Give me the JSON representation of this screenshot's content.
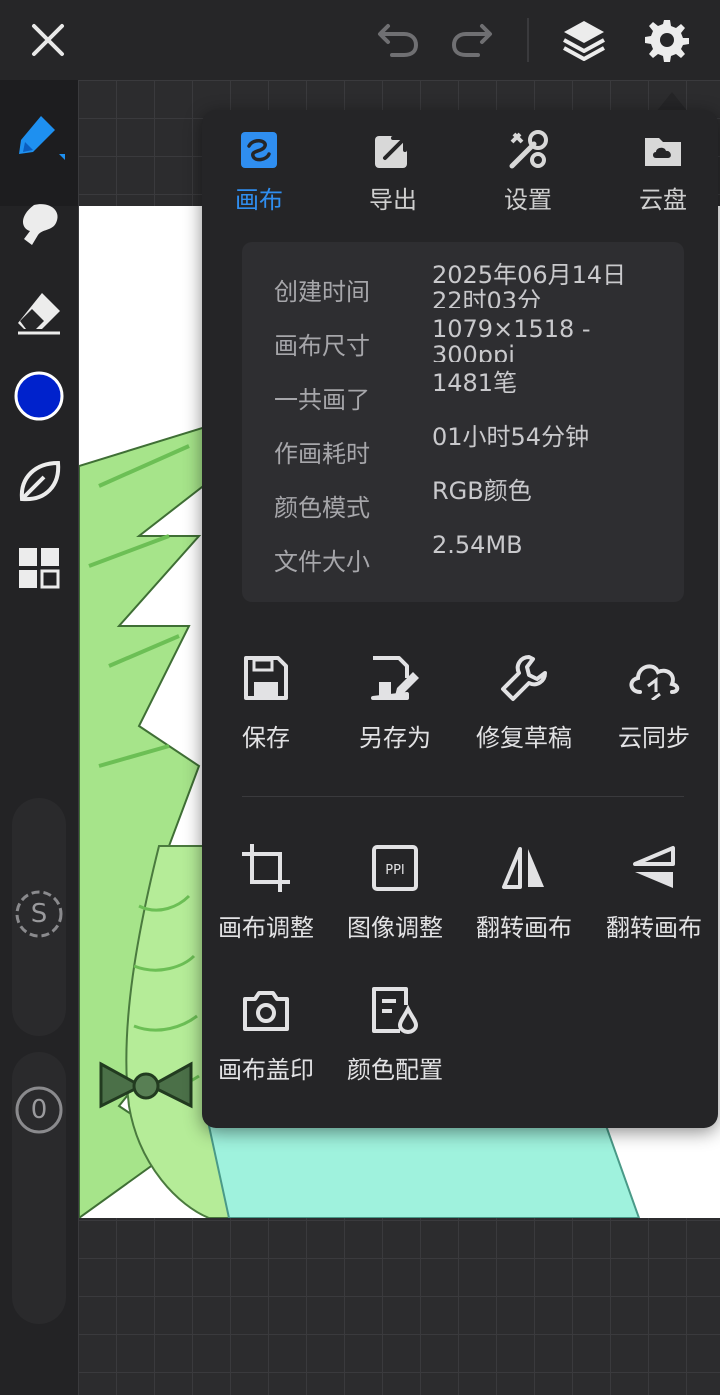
{
  "toolbar": {
    "close_icon": "close-icon",
    "undo_icon": "undo-icon",
    "redo_icon": "redo-icon",
    "layers_icon": "layers-icon",
    "settings_icon": "gear-icon"
  },
  "left_tools": {
    "active_color": "#0022cc",
    "slider_size_label": "S",
    "slider_opacity_label": "0"
  },
  "panel": {
    "tabs": [
      {
        "label": "画布",
        "icon": "canvas-icon",
        "active": true
      },
      {
        "label": "导出",
        "icon": "export-icon",
        "active": false
      },
      {
        "label": "设置",
        "icon": "tools-icon",
        "active": false
      },
      {
        "label": "云盘",
        "icon": "cloud-drive-icon",
        "active": false
      }
    ],
    "info": [
      {
        "key": "创建时间",
        "value": "2025年06月14日 22时03分"
      },
      {
        "key": "画布尺寸",
        "value": "1079×1518 - 300ppi"
      },
      {
        "key": "一共画了",
        "value": "1481笔"
      },
      {
        "key": "作画耗时",
        "value": "01小时54分钟"
      },
      {
        "key": "颜色模式",
        "value": "RGB颜色"
      },
      {
        "key": "文件大小",
        "value": "2.54MB"
      }
    ],
    "actions_row1": [
      {
        "label": "保存",
        "icon": "save-icon"
      },
      {
        "label": "另存为",
        "icon": "save-as-icon"
      },
      {
        "label": "修复草稿",
        "icon": "wrench-icon"
      },
      {
        "label": "云同步",
        "icon": "cloud-sync-icon"
      }
    ],
    "actions_row2": [
      {
        "label": "画布调整",
        "icon": "crop-icon"
      },
      {
        "label": "图像调整",
        "icon": "ppi-icon"
      },
      {
        "label": "翻转画布",
        "icon": "flip-horizontal-icon"
      },
      {
        "label": "翻转画布",
        "icon": "flip-vertical-icon"
      }
    ],
    "actions_row3": [
      {
        "label": "画布盖印",
        "icon": "camera-icon"
      },
      {
        "label": "颜色配置",
        "icon": "color-profile-icon"
      }
    ],
    "accent_color": "#2f8ef0"
  }
}
